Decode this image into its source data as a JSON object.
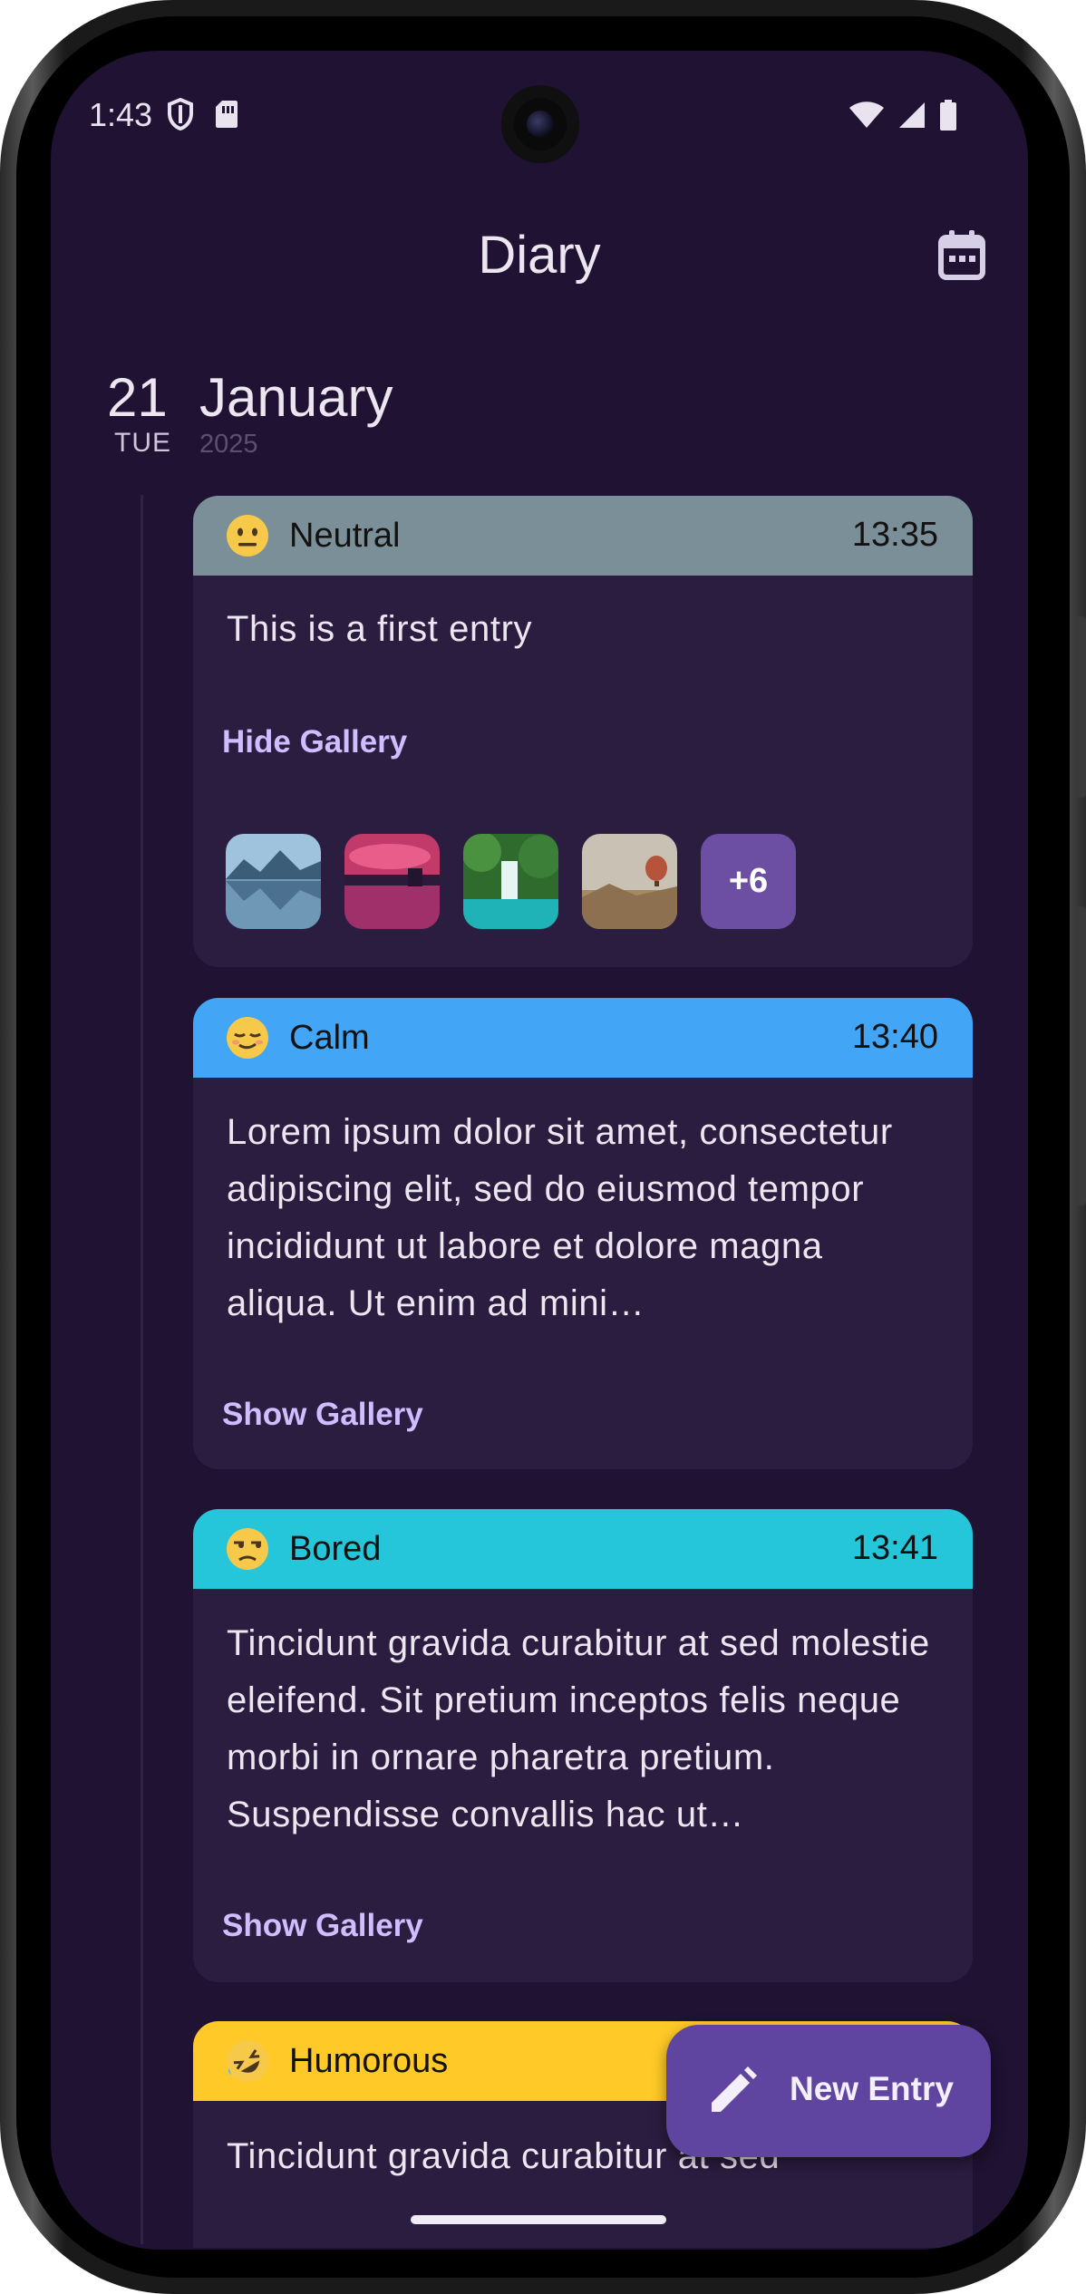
{
  "status_bar": {
    "time": "1:43",
    "left_icons": [
      "shield-icon",
      "sim-card-icon"
    ],
    "right_icons": [
      "wifi-icon",
      "signal-icon",
      "battery-icon"
    ]
  },
  "top_bar": {
    "title": "Diary",
    "calendar_icon": "calendar-icon"
  },
  "date_header": {
    "day": "21",
    "weekday": "TUE",
    "month": "January",
    "year": "2025"
  },
  "entries": [
    {
      "mood": "Neutral",
      "emoji": "neutral-face",
      "time": "13:35",
      "color": "#7b8f99",
      "text": "This is a first entry",
      "gallery_label": "Hide Gallery",
      "thumbnails": [
        "lake-mountains",
        "sunset-lake",
        "waterfall",
        "hot-air-balloon"
      ],
      "more_count": "+6"
    },
    {
      "mood": "Calm",
      "emoji": "relieved-face",
      "time": "13:40",
      "color": "#42a5f5",
      "text": "Lorem ipsum dolor sit amet, consectetur adipiscing elit, sed do eiusmod tempor incididunt ut labore et dolore magna aliqua. Ut enim ad mini…",
      "gallery_label": "Show Gallery"
    },
    {
      "mood": "Bored",
      "emoji": "unamused-face",
      "time": "13:41",
      "color": "#26c6da",
      "text": "Tincidunt gravida curabitur at sed molestie eleifend. Sit pretium inceptos felis neque morbi in ornare pharetra pretium. Suspendisse convallis hac ut…",
      "gallery_label": "Show Gallery"
    },
    {
      "mood": "Humorous",
      "emoji": "rolling-laughing-face",
      "color": "#ffca28",
      "text": "Tincidunt gravida curabitur at sed"
    }
  ],
  "fab": {
    "label": "New Entry",
    "icon": "pencil-icon"
  }
}
